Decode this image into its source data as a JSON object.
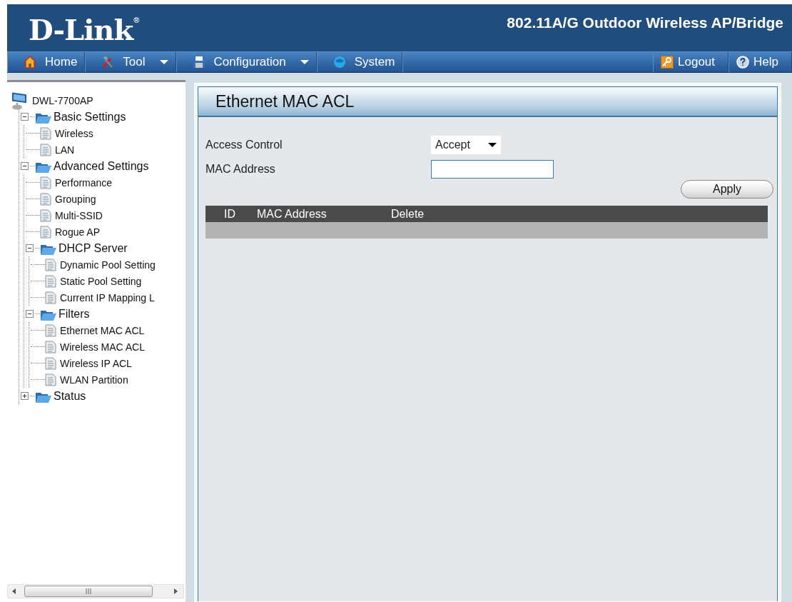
{
  "header": {
    "logo": "D-Link",
    "logo_mark": "®",
    "product": "802.11A/G Outdoor Wireless AP/Bridge"
  },
  "nav": {
    "left": [
      {
        "label": "Home",
        "dropdown": false
      },
      {
        "label": "Tool",
        "dropdown": true
      },
      {
        "label": "Configuration",
        "dropdown": true
      },
      {
        "label": "System",
        "dropdown": false
      }
    ],
    "right": [
      {
        "label": "Logout"
      },
      {
        "label": "Help"
      }
    ]
  },
  "sidebar": {
    "tree": {
      "label": "DWL-7700AP",
      "kind": "device",
      "children": [
        {
          "label": "Basic Settings",
          "kind": "folder",
          "expanded": true,
          "children": [
            {
              "label": "Wireless",
              "kind": "page"
            },
            {
              "label": "LAN",
              "kind": "page"
            }
          ]
        },
        {
          "label": "Advanced Settings",
          "kind": "folder",
          "expanded": true,
          "children": [
            {
              "label": "Performance",
              "kind": "page"
            },
            {
              "label": "Grouping",
              "kind": "page"
            },
            {
              "label": "Multi-SSID",
              "kind": "page"
            },
            {
              "label": "Rogue AP",
              "kind": "page"
            },
            {
              "label": "DHCP Server",
              "kind": "folder",
              "expanded": true,
              "children": [
                {
                  "label": "Dynamic Pool Setting",
                  "kind": "page"
                },
                {
                  "label": "Static Pool Setting",
                  "kind": "page"
                },
                {
                  "label": "Current IP Mapping L",
                  "kind": "page"
                }
              ]
            },
            {
              "label": "Filters",
              "kind": "folder",
              "expanded": true,
              "children": [
                {
                  "label": "Ethernet MAC ACL",
                  "kind": "page"
                },
                {
                  "label": "Wireless MAC ACL",
                  "kind": "page"
                },
                {
                  "label": "Wireless IP ACL",
                  "kind": "page"
                },
                {
                  "label": "WLAN Partition",
                  "kind": "page"
                }
              ]
            }
          ]
        },
        {
          "label": "Status",
          "kind": "folder",
          "expanded": false
        }
      ]
    }
  },
  "panel": {
    "title": "Ethernet MAC ACL",
    "fields": [
      {
        "label": "Access Control",
        "kind": "select",
        "value": "Accept"
      },
      {
        "label": "MAC Address",
        "kind": "text"
      }
    ],
    "apply_button": "Apply",
    "table": {
      "columns": [
        "ID",
        "MAC Address",
        "Delete"
      ]
    }
  }
}
